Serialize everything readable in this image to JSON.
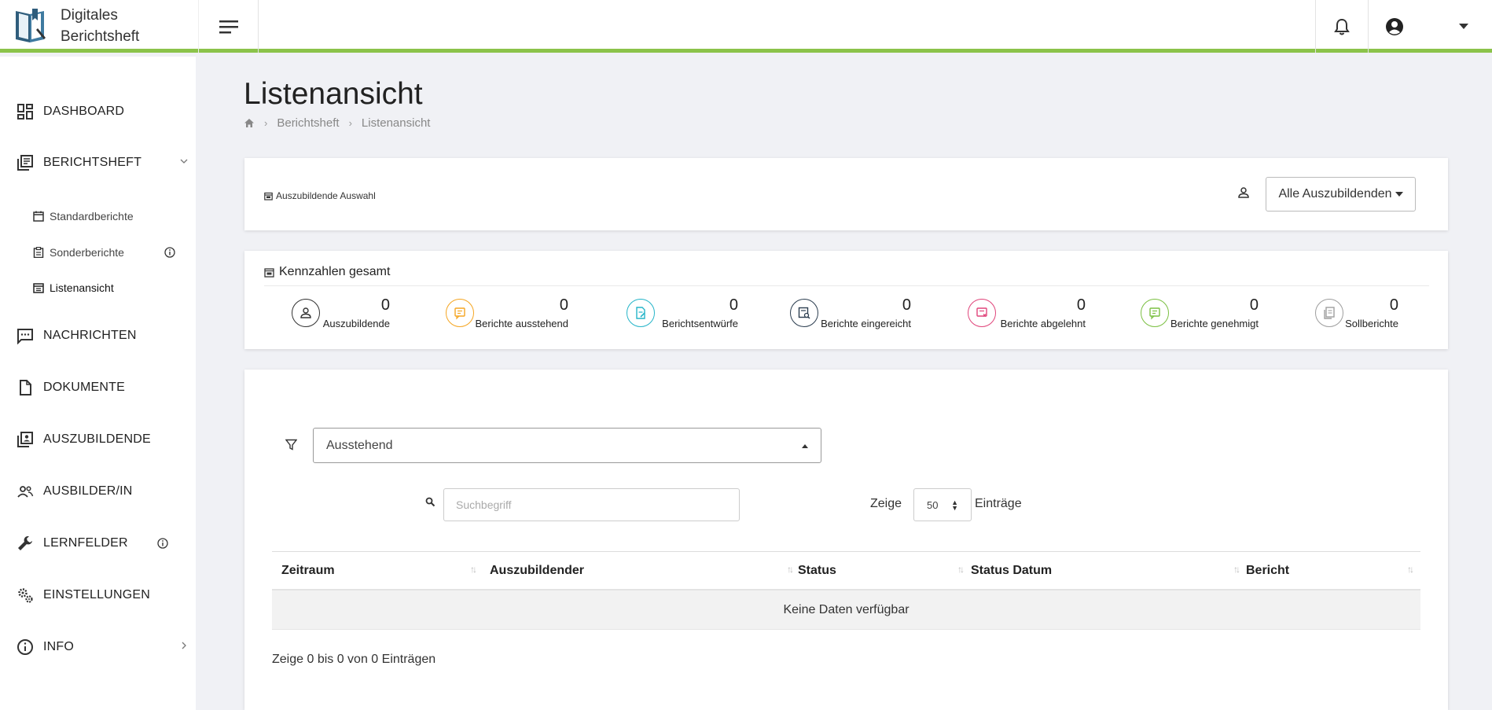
{
  "app": {
    "name_line1": "Digitales",
    "name_line2": "Berichtsheft"
  },
  "header": {
    "menu_icon": "hamburger-icon",
    "notification_icon": "bell-icon",
    "user_icon": "account-circle-icon",
    "user_menu_icon": "caret-down-icon"
  },
  "sidebar": {
    "dashboard": "DASHBOARD",
    "berichtsheft": "BERICHTSHEFT",
    "sub": {
      "standardberichte": "Standardberichte",
      "sonderberichte": "Sonderberichte",
      "listenansicht": "Listenansicht"
    },
    "nachrichten": "NACHRICHTEN",
    "dokumente": "DOKUMENTE",
    "auszubildende": "AUSZUBILDENDE",
    "ausbilder": "AUSBILDER/IN",
    "lernfelder": "LERNFELDER",
    "einstellungen": "EINSTELLUNGEN",
    "info": "INFO"
  },
  "page": {
    "title": "Listenansicht",
    "breadcrumb": [
      "Berichtsheft",
      "Listenansicht"
    ]
  },
  "selection": {
    "label": "Auszubildende Auswahl",
    "dropdown_value": "Alle Auszubildenden"
  },
  "kennzahlen": {
    "title": "Kennzahlen gesamt",
    "stats": [
      {
        "label": "Auszubildende",
        "value": "0",
        "color": "#333333",
        "icon": "person-icon"
      },
      {
        "label": "Berichte ausstehend",
        "value": "0",
        "color": "#f5a623",
        "icon": "report-pending-icon"
      },
      {
        "label": "Berichtsentwürfe",
        "value": "0",
        "color": "#26b5c9",
        "icon": "report-draft-icon"
      },
      {
        "label": "Berichte eingereicht",
        "value": "0",
        "color": "#2c3e50",
        "icon": "report-submitted-icon"
      },
      {
        "label": "Berichte abgelehnt",
        "value": "0",
        "color": "#e0457b",
        "icon": "report-rejected-icon"
      },
      {
        "label": "Berichte genehmigt",
        "value": "0",
        "color": "#7cc043",
        "icon": "report-approved-icon"
      },
      {
        "label": "Sollberichte",
        "value": "0",
        "color": "#9e9e9e",
        "icon": "report-target-icon"
      }
    ]
  },
  "list": {
    "filter_value": "Ausstehend",
    "search_placeholder": "Suchbegriff",
    "show_label": "Zeige",
    "page_length": "50",
    "entries_label": "Einträge",
    "columns": [
      "Zeitraum",
      "Auszubildender",
      "Status",
      "Status Datum",
      "Bericht"
    ],
    "empty_message": "Keine Daten verfügbar",
    "info": "Zeige 0 bis 0 von 0 Einträgen"
  }
}
